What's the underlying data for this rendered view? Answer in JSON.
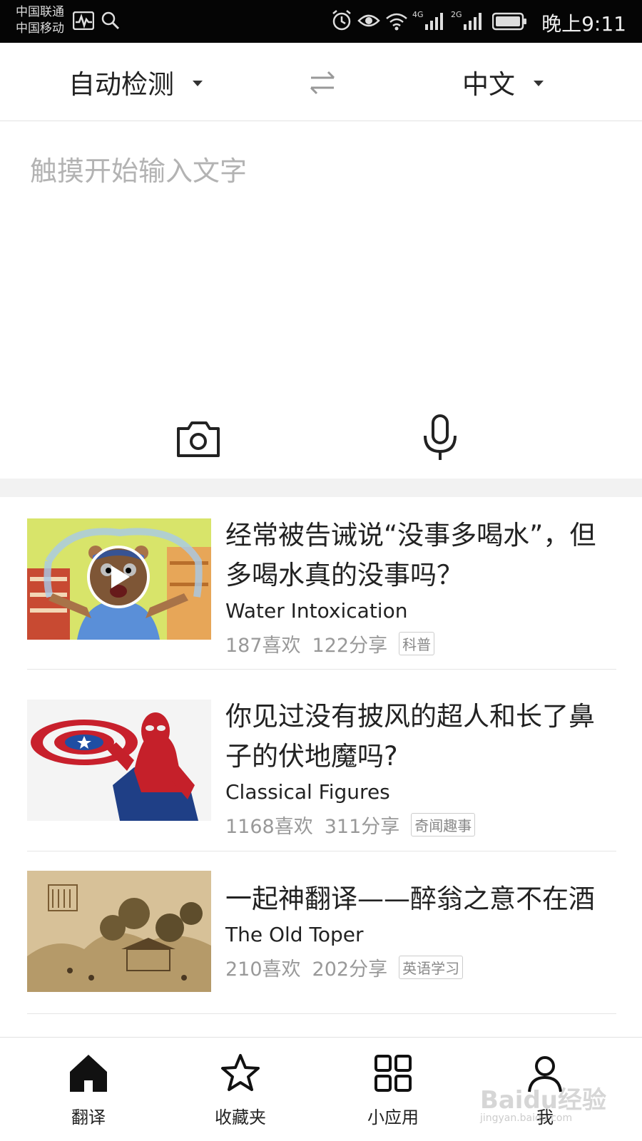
{
  "status_bar": {
    "carrier_1": "中国联通",
    "carrier_2": "中国移动",
    "network_1": "4G",
    "network_2": "2G",
    "time": "晚上9:11"
  },
  "lang_bar": {
    "source_lang": "自动检测",
    "target_lang": "中文",
    "swap_icon": "swap-arrows-icon"
  },
  "input": {
    "placeholder": "触摸开始输入文字",
    "camera_icon": "camera-icon",
    "mic_icon": "microphone-icon"
  },
  "articles": [
    {
      "title": "经常被告诫说“没事多喝水”，但多喝水真的没事吗？",
      "title_en": "Water Intoxication",
      "likes": "187喜欢",
      "shares": "122分享",
      "tag": "科普",
      "is_video": true
    },
    {
      "title": "你见过没有披风的超人和长了鼻子的伏地魔吗?",
      "title_en": "Classical Figures",
      "likes": "1168喜欢",
      "shares": "311分享",
      "tag": "奇闻趣事",
      "is_video": false
    },
    {
      "title": "一起神翻译——醉翁之意不在酒",
      "title_en": "The Old Toper",
      "likes": "210喜欢",
      "shares": "202分享",
      "tag": "英语学习",
      "is_video": false
    }
  ],
  "tabs": [
    {
      "label": "翻译",
      "icon": "home-icon",
      "active": true
    },
    {
      "label": "收藏夹",
      "icon": "star-icon",
      "active": false
    },
    {
      "label": "小应用",
      "icon": "grid-icon",
      "active": false
    },
    {
      "label": "我",
      "icon": "user-icon",
      "active": false
    }
  ],
  "watermark": {
    "text": "Baidu经验",
    "url_text": "jingyan.baidu.com"
  },
  "colors": {
    "status_bar_bg": "#050505",
    "placeholder": "#b3b3b3",
    "meta_text": "#999999",
    "divider": "#e5e5e5"
  }
}
